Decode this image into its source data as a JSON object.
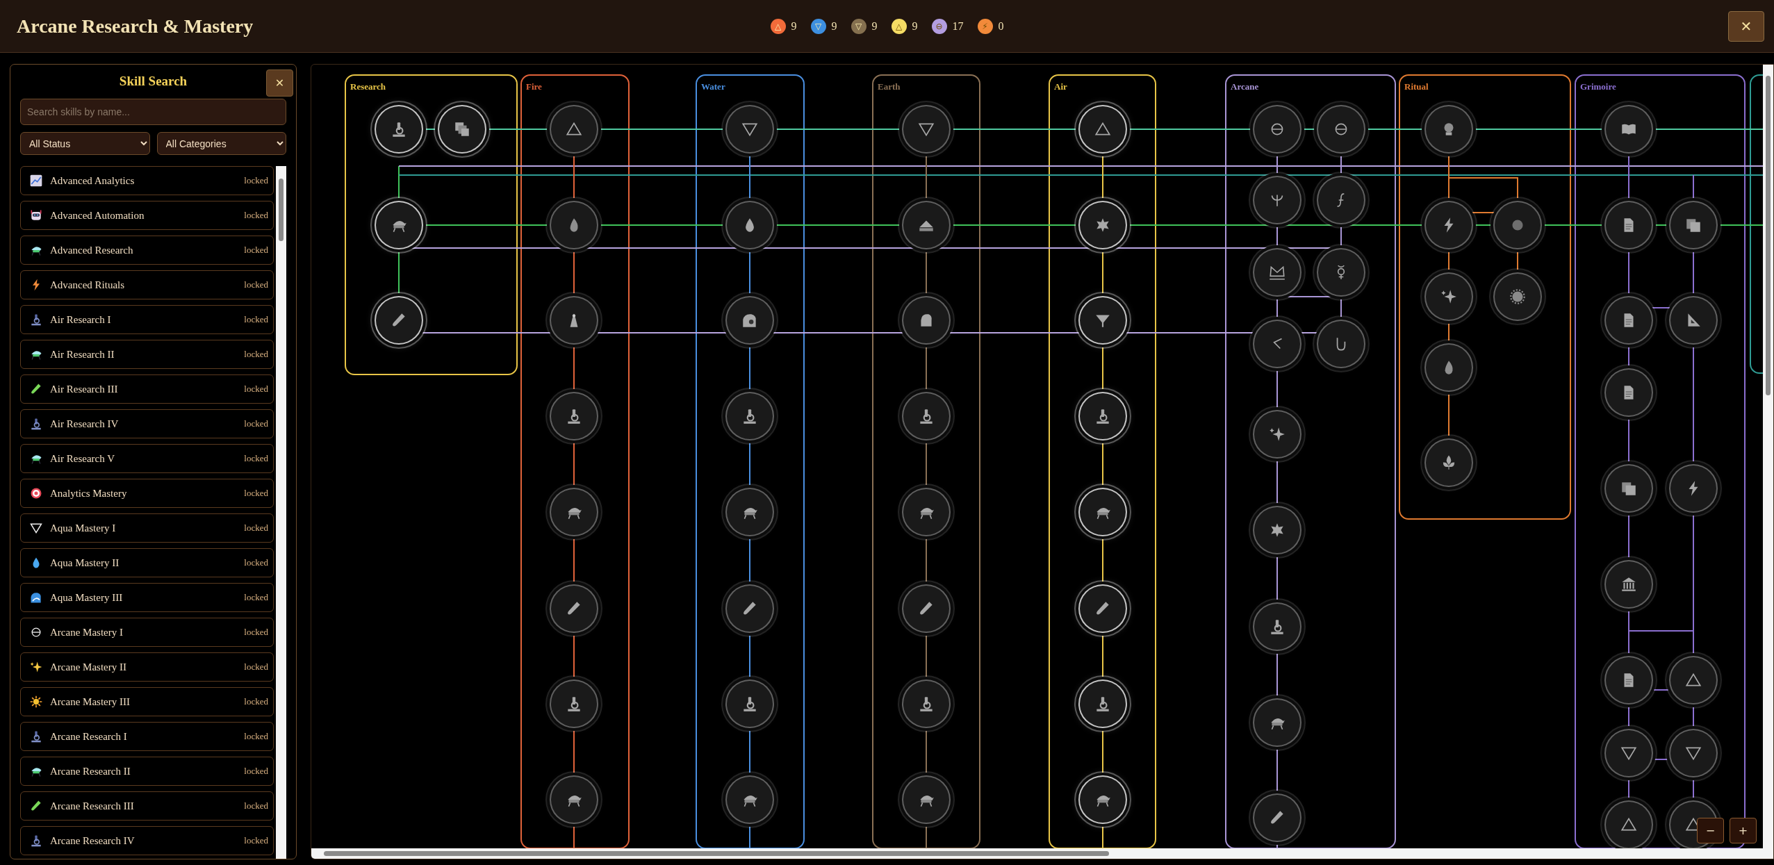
{
  "header": {
    "title": "Arcane Research & Mastery",
    "close": "✕",
    "counters": [
      {
        "symbol": "△",
        "count": "9",
        "color": "#f26b3a"
      },
      {
        "symbol": "▽",
        "count": "9",
        "color": "#3d8fe0"
      },
      {
        "symbol": "▽",
        "count": "9",
        "color": "#85704f"
      },
      {
        "symbol": "△",
        "count": "9",
        "color": "#f5dc64"
      },
      {
        "symbol": "⊖",
        "count": "17",
        "color": "#b39de0"
      },
      {
        "symbol": "⚡",
        "count": "0",
        "color": "#f28a3a"
      }
    ]
  },
  "sidebar": {
    "title": "Skill Search",
    "close": "✕",
    "search": {
      "placeholder": "Search skills by name..."
    },
    "filters": [
      {
        "value": "All Status"
      },
      {
        "value": "All Categories"
      }
    ],
    "skills": [
      {
        "name": "Advanced Analytics",
        "status": "locked"
      },
      {
        "name": "Advanced Automation",
        "status": "locked"
      },
      {
        "name": "Advanced Research",
        "status": "locked"
      },
      {
        "name": "Advanced Rituals",
        "status": "locked"
      },
      {
        "name": "Air Research I",
        "status": "locked"
      },
      {
        "name": "Air Research II",
        "status": "locked"
      },
      {
        "name": "Air Research III",
        "status": "locked"
      },
      {
        "name": "Air Research IV",
        "status": "locked"
      },
      {
        "name": "Air Research V",
        "status": "locked"
      },
      {
        "name": "Analytics Mastery",
        "status": "locked"
      },
      {
        "name": "Aqua Mastery I",
        "status": "locked"
      },
      {
        "name": "Aqua Mastery II",
        "status": "locked"
      },
      {
        "name": "Aqua Mastery III",
        "status": "locked"
      },
      {
        "name": "Arcane Mastery I",
        "status": "locked"
      },
      {
        "name": "Arcane Mastery II",
        "status": "locked"
      },
      {
        "name": "Arcane Mastery III",
        "status": "locked"
      },
      {
        "name": "Arcane Research I",
        "status": "locked"
      },
      {
        "name": "Arcane Research II",
        "status": "locked"
      },
      {
        "name": "Arcane Research III",
        "status": "locked"
      },
      {
        "name": "Arcane Research IV",
        "status": "locked"
      }
    ]
  },
  "tree": {
    "zoom_buttons": [
      "−",
      "+"
    ],
    "lanes": [
      {
        "label": "Research",
        "color": "#e8c547",
        "nodes": [
          {
            "available": true
          },
          {
            "available": true
          },
          {
            "available": true
          },
          {
            "available": true
          }
        ]
      },
      {
        "label": "Fire",
        "color": "#e0623a",
        "nodes": [
          {
            "available": false
          },
          {
            "available": false
          },
          {
            "available": false
          },
          {
            "available": false
          },
          {
            "available": false
          },
          {
            "available": false
          },
          {
            "available": false
          },
          {
            "available": false
          }
        ]
      },
      {
        "label": "Water",
        "color": "#4a8fe0",
        "nodes": [
          {
            "available": false
          },
          {
            "available": false
          },
          {
            "available": false
          },
          {
            "available": false
          },
          {
            "available": false
          },
          {
            "available": false
          },
          {
            "available": false
          },
          {
            "available": false
          }
        ]
      },
      {
        "label": "Earth",
        "color": "#8a7055",
        "nodes": [
          {
            "available": false
          },
          {
            "available": false
          },
          {
            "available": false
          },
          {
            "available": false
          },
          {
            "available": false
          },
          {
            "available": false
          },
          {
            "available": false
          },
          {
            "available": false
          }
        ]
      },
      {
        "label": "Air",
        "color": "#e8c547",
        "nodes": [
          {
            "available": true
          },
          {
            "available": true
          },
          {
            "available": true
          },
          {
            "available": true
          },
          {
            "available": true
          },
          {
            "available": true
          },
          {
            "available": true
          },
          {
            "available": true
          }
        ]
      },
      {
        "label": "Arcane",
        "color": "#a995d6",
        "nodes": [
          {
            "available": false
          },
          {
            "available": false
          },
          {
            "available": false
          },
          {
            "available": false
          },
          {
            "available": false
          },
          {
            "available": false
          },
          {
            "available": false
          },
          {
            "available": false
          },
          {
            "available": false
          },
          {
            "available": false
          },
          {
            "available": false
          },
          {
            "available": false
          },
          {
            "available": false
          }
        ]
      },
      {
        "label": "Ritual",
        "color": "#e07a30",
        "nodes": [
          {
            "available": false
          },
          {
            "available": false
          },
          {
            "available": false
          },
          {
            "available": false
          },
          {
            "available": false
          },
          {
            "available": false
          },
          {
            "available": false
          }
        ]
      },
      {
        "label": "Grimoire",
        "color": "#8b6fd0",
        "nodes": [
          {
            "available": false
          },
          {
            "available": false
          },
          {
            "available": false
          },
          {
            "available": false
          },
          {
            "available": false
          },
          {
            "available": false
          },
          {
            "available": false
          },
          {
            "available": false
          },
          {
            "available": false
          },
          {
            "available": false
          },
          {
            "available": false
          },
          {
            "available": false
          },
          {
            "available": false
          },
          {
            "available": false
          },
          {
            "available": false
          }
        ]
      },
      {
        "color": "#2f9c94"
      }
    ]
  }
}
